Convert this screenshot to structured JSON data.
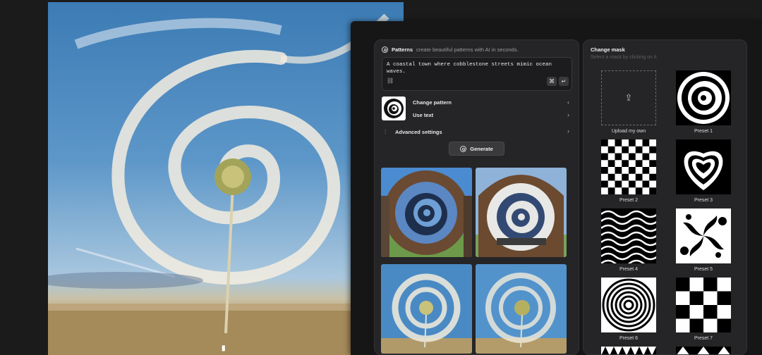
{
  "patterns_panel": {
    "title": "Patterns",
    "subtitle": "create beautiful patterns with AI in seconds.",
    "prompt_value": "A coastal town where cobblestone streets mimic ocean waves.",
    "kbd_cmd": "⌘",
    "kbd_enter": "↵",
    "change_pattern_label": "Change pattern",
    "use_text_label": "Use text",
    "advanced_settings_label": "Advanced settings",
    "generate_label": "Generate"
  },
  "mask_panel": {
    "title": "Change mask",
    "subtitle": "Select a mask by clicking on it.",
    "items": [
      {
        "label": "Upload my own"
      },
      {
        "label": "Preset 1"
      },
      {
        "label": "Preset 2"
      },
      {
        "label": "Preset 3"
      },
      {
        "label": "Preset 4"
      },
      {
        "label": "Preset 5"
      },
      {
        "label": "Preset 6"
      },
      {
        "label": "Preset 7"
      }
    ]
  },
  "hero": {
    "badge": "",
    "corner_text": "m"
  },
  "colors": {
    "background": "#1b1b1c",
    "panel": "#252527",
    "overlay": "#161617",
    "sky": "#3c7bb4"
  }
}
